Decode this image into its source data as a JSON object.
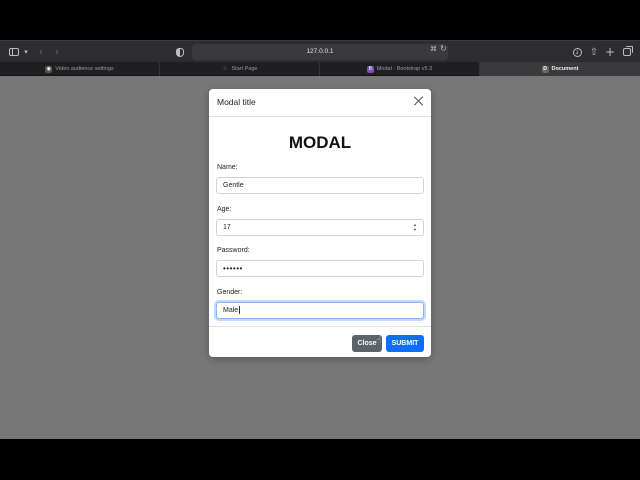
{
  "browser": {
    "address": "127.0.0.1",
    "tabs": [
      {
        "label": "Video audience settings",
        "active": false
      },
      {
        "label": "Start Page",
        "active": false
      },
      {
        "label": "Modal · Bootstrap v5.3",
        "active": false
      },
      {
        "label": "Document",
        "active": true
      }
    ],
    "icons": {
      "sidebar": "sidebar-icon",
      "back": "chevron-left-icon",
      "forward": "chevron-right-icon",
      "reload": "reload-icon",
      "download": "download-icon",
      "share": "share-icon",
      "new_tab": "plus-icon",
      "tab_overview": "tabs-icon"
    },
    "glyphs": {
      "chevron_down": "▾",
      "back": "‹",
      "forward": "›",
      "translate": "⌘",
      "reload": "↻",
      "download": "↓",
      "share": "⇧",
      "new_tab": "+",
      "tab1_icon": "◉",
      "tab2_icon": "☆",
      "tab3_icon": "B",
      "tab4_icon": "D"
    }
  },
  "modal": {
    "title": "Modal title",
    "heading": "MODAL",
    "fields": {
      "name": {
        "label": "Name:",
        "value": "Gentle"
      },
      "age": {
        "label": "Age:",
        "value": "17"
      },
      "password": {
        "label": "Password:",
        "value": "••••••"
      },
      "gender": {
        "label": "Gender:",
        "value": "Male"
      }
    },
    "spinner": {
      "up": "▲",
      "down": "▼"
    },
    "buttons": {
      "close": "Close",
      "submit": "SUBMIT"
    },
    "pointer": "☝"
  },
  "colors": {
    "primary": "#0d6efd",
    "secondary": "#5c636a",
    "backdrop": "#777777"
  }
}
